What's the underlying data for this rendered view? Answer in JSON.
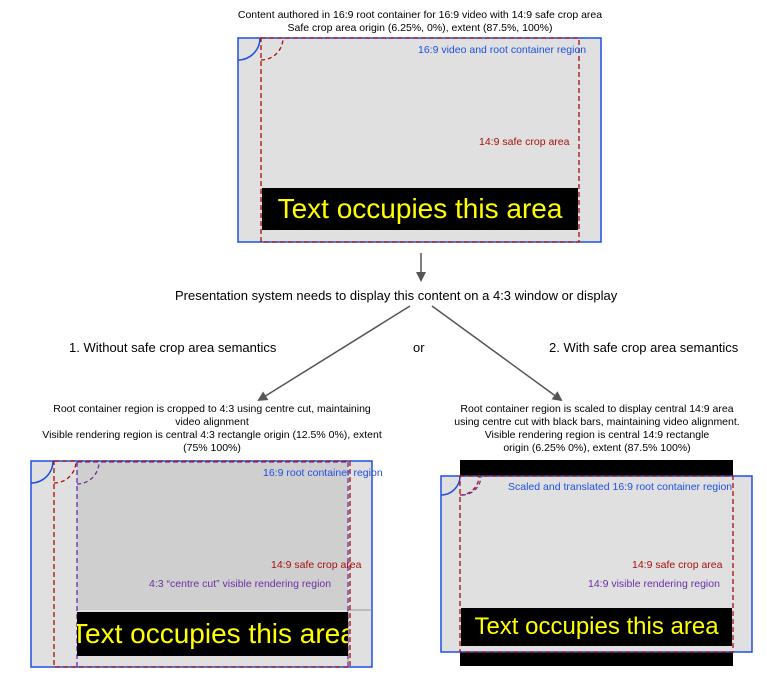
{
  "colors": {
    "blue": "#1f4fe0",
    "red": "#a8100c",
    "purple": "#6a2fa8",
    "gray": "#e0e0e0",
    "yellow": "#ffff00"
  },
  "top": {
    "caption_line1": "Content authored in 16:9 root container for 16:9 video with 14:9 safe crop area",
    "caption_line2": "Safe crop area origin (6.25%, 0%), extent (87.5%, 100%)",
    "root_label": "16:9 video and root container region",
    "safe_label": "14:9 safe crop area",
    "text_area": "Text occupies this area"
  },
  "middle": {
    "presentation": "Presentation system needs to display this content on a 4:3 window or display",
    "option1": "1. Without safe crop area semantics",
    "or": "or",
    "option2": "2. With safe crop area semantics"
  },
  "left": {
    "caption_line1": "Root container region is cropped to 4:3 using centre cut, maintaining",
    "caption_line2": "video alignment",
    "caption_line3": "Visible rendering region is central 4:3 rectangle origin (12.5% 0%), extent",
    "caption_line4": "(75% 100%)",
    "root_label": "16:9 root container region",
    "safe_label": "14:9 safe crop area",
    "visible_label": "4:3 “centre cut” visible rendering region",
    "text_area": "Text occupies this area"
  },
  "right": {
    "caption_line1": "Root container region is scaled to display central 14:9 area",
    "caption_line2": "using centre cut with black bars, maintaining video alignment.",
    "caption_line3": "Visible rendering region is central 14:9 rectangle",
    "caption_line4": "origin (6.25% 0%), extent (87.5% 100%)",
    "root_label": "Scaled and translated 16:9 root container region",
    "safe_label": "14:9 safe crop area",
    "visible_label": "14:9 visible rendering region",
    "text_area": "Text occupies this area"
  }
}
